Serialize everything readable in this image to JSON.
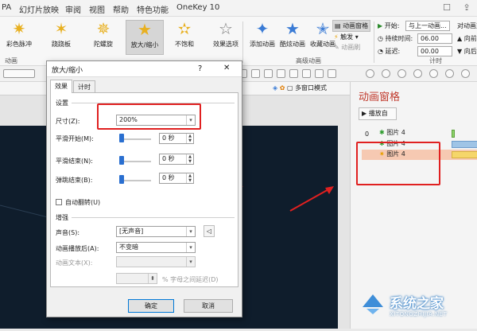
{
  "menubar": {
    "tabs": [
      "PA",
      "幻灯片放映",
      "审阅",
      "视图",
      "帮助",
      "特色功能",
      "OneKey 10"
    ]
  },
  "ribbon": {
    "effects": [
      {
        "label": "彩色脉冲",
        "icon": "star-pulse-icon"
      },
      {
        "label": "跷跷板",
        "icon": "star-teeter-icon"
      },
      {
        "label": "陀螺旋",
        "icon": "star-spin-icon"
      },
      {
        "label": "放大/缩小",
        "icon": "star-grow-icon"
      },
      {
        "label": "不饱和",
        "icon": "star-desaturate-icon"
      }
    ],
    "effect_options_label": "效果选项",
    "group_animation": "动画",
    "add_animation": "添加动画",
    "painter": "酷炫动画",
    "favorites": "收藏动画",
    "anim_pane_btn": "动画窗格",
    "trigger": "触发",
    "anim_painter": "动画刷",
    "group_advanced": "高级动画",
    "start_label": "开始:",
    "start_value": "与上一动画...",
    "duration_label": "持续时间:",
    "duration_value": "06.00",
    "delay_label": "延迟:",
    "delay_value": "00.00",
    "reorder": "对动画重",
    "move_earlier": "向前",
    "move_later": "向后",
    "group_timing": "计时"
  },
  "strip": {
    "multiwindow": "多窗口模式"
  },
  "anim_pane": {
    "title": "动画窗格",
    "play_btn": "播放自",
    "items": [
      {
        "index": "0",
        "name": "图片 4"
      },
      {
        "index": "",
        "name": "图片 4"
      },
      {
        "index": "",
        "name": "图片 4"
      }
    ]
  },
  "dialog": {
    "title": "放大/缩小",
    "help": "?",
    "close": "✕",
    "tabs": [
      "效果",
      "计时"
    ],
    "section_settings": "设置",
    "size_label": "尺寸(Z):",
    "size_value": "200%",
    "smooth_start_label": "平滑开始(M):",
    "smooth_start_value": "0 秒",
    "smooth_end_label": "平滑结束(N):",
    "smooth_end_value": "0 秒",
    "bounce_end_label": "弹跳结束(B):",
    "bounce_end_value": "0 秒",
    "auto_reverse_label": "自动翻转(U)",
    "section_enhance": "增强",
    "sound_label": "声音(S):",
    "sound_value": "[无声音]",
    "after_label": "动画播放后(A):",
    "after_value": "不变暗",
    "text_label": "动画文本(X):",
    "letter_delay_label": "% 字母之间延迟(D)",
    "ok": "确定",
    "cancel": "取消"
  },
  "watermark": {
    "text": "系统之家",
    "url": "XITONGZHIJIA.NET"
  },
  "colors": {
    "accent_red": "#e02020",
    "slide_bg": "#0f1d2c",
    "pane_title": "#c0392b"
  }
}
